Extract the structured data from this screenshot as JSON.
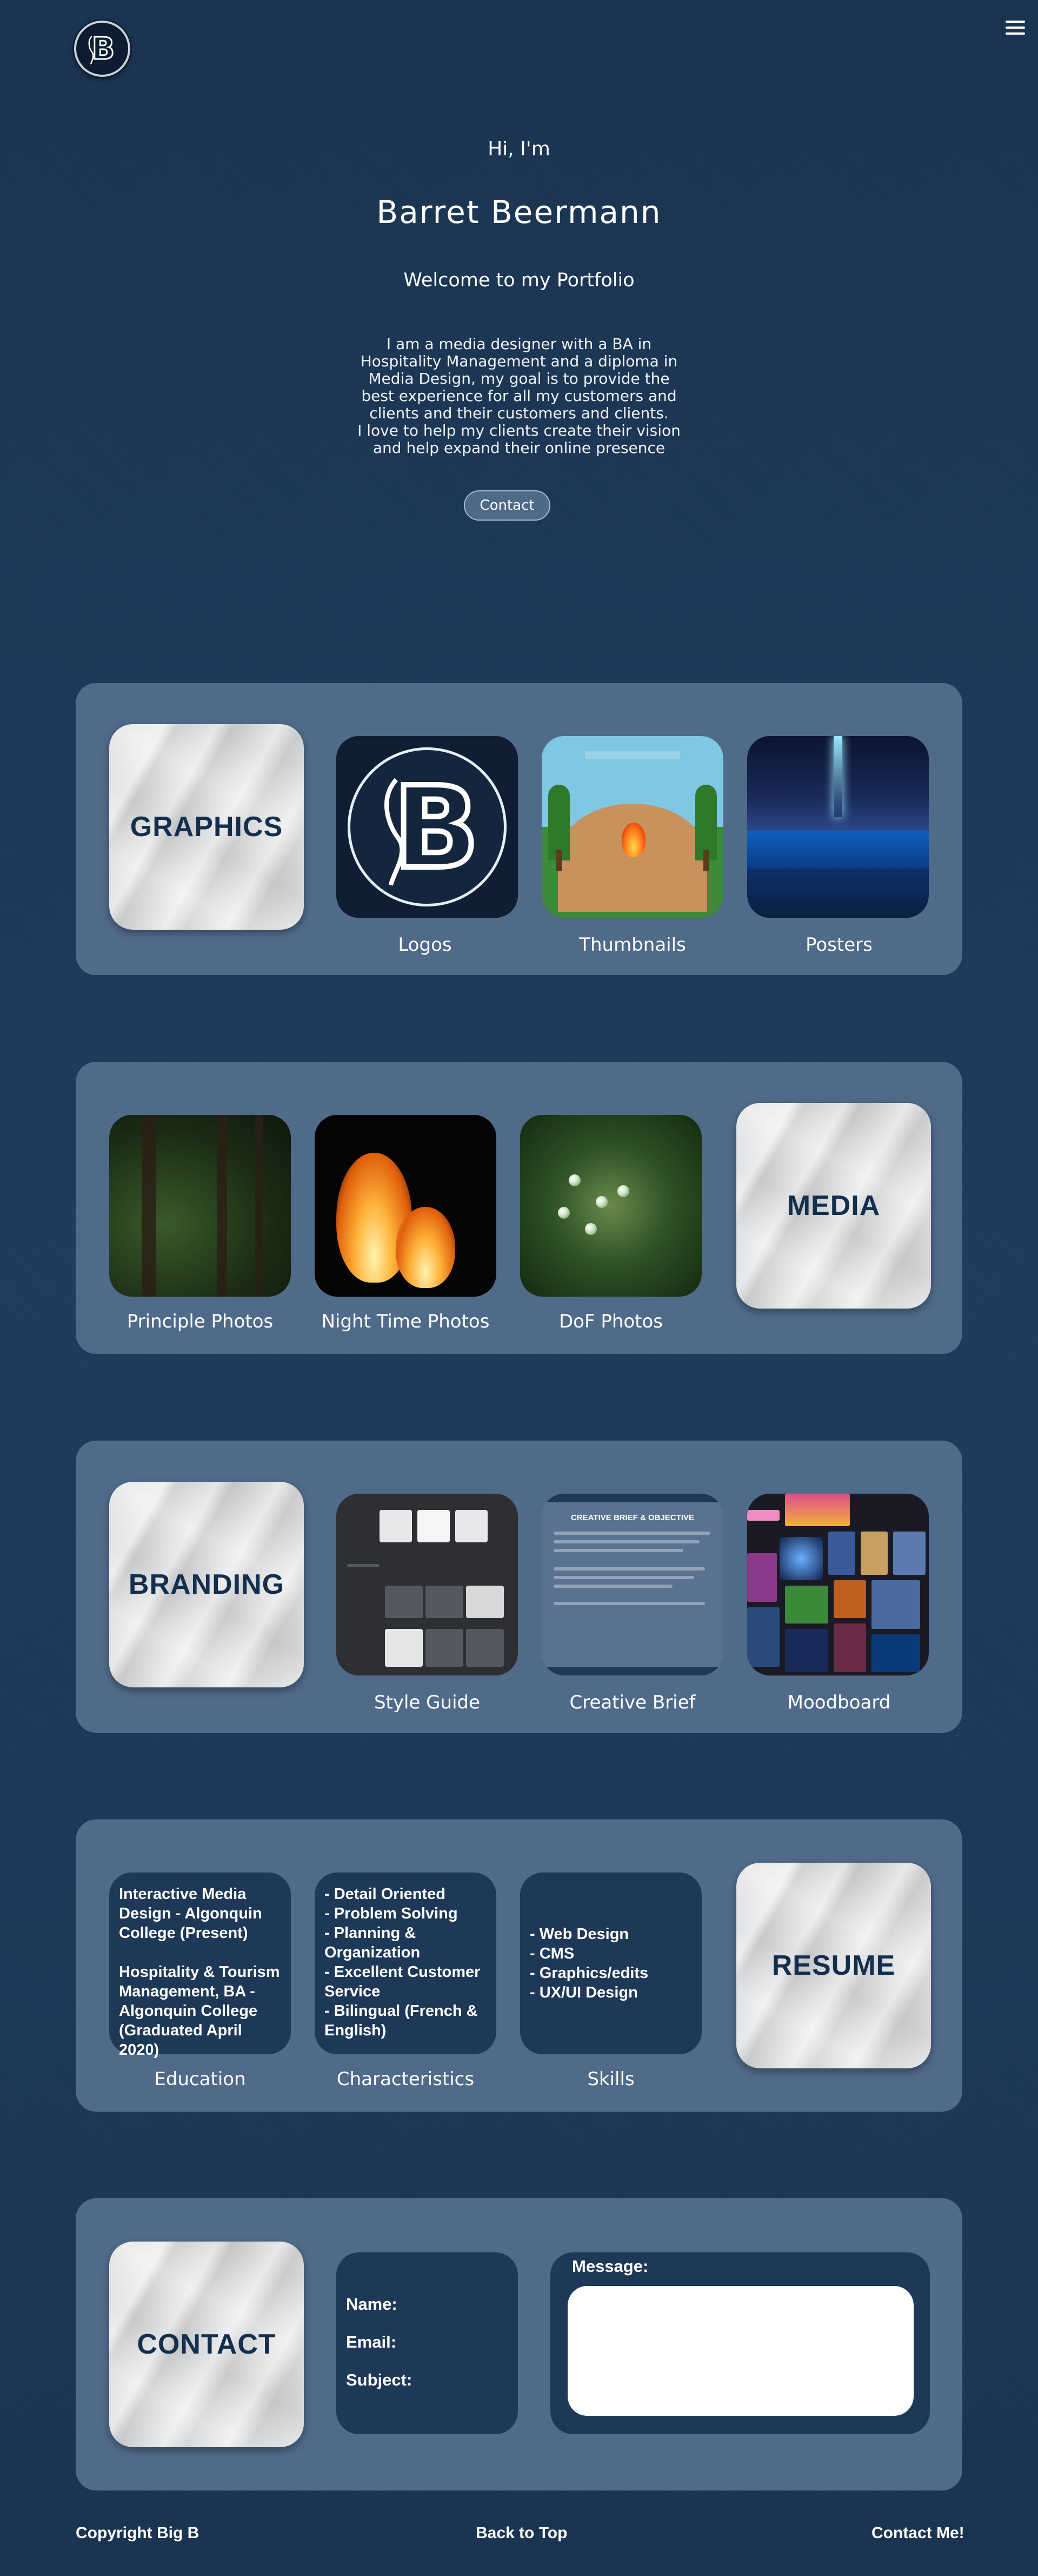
{
  "header": {
    "logo_letter": "B",
    "menu_icon": "hamburger-menu-icon"
  },
  "hero": {
    "greeting": "Hi, I'm",
    "name": "Barret Beermann",
    "welcome": "Welcome to my Portfolio",
    "bio_lines": [
      "I am a media designer with a BA in",
      "Hospitality Management and a diploma in",
      "Media Design, my goal is to provide the",
      "best experience for all my customers and",
      "clients and their customers and clients.",
      "I love to help my clients create their vision",
      "and help expand their online presence"
    ],
    "contact_button": "Contact"
  },
  "graphics": {
    "title": "GRAPHICS",
    "items": [
      {
        "label": "Logos"
      },
      {
        "label": "Thumbnails"
      },
      {
        "label": "Posters"
      }
    ]
  },
  "media": {
    "title": "MEDIA",
    "items": [
      {
        "label": "Principle Photos"
      },
      {
        "label": "Night Time Photos"
      },
      {
        "label": "DoF Photos"
      }
    ]
  },
  "branding": {
    "title": "BRANDING",
    "creative_brief_heading": "CREATIVE BRIEF & OBJECTIVE",
    "items": [
      {
        "label": "Style Guide"
      },
      {
        "label": "Creative Brief"
      },
      {
        "label": "Moodboard"
      }
    ]
  },
  "resume": {
    "title": "RESUME",
    "education_lines": [
      "Interactive Media",
      "Design - Algonquin",
      "College (Present)",
      "",
      "Hospitality & Tourism",
      "Management, BA -",
      "Algonquin College",
      "(Graduated April 2020)"
    ],
    "characteristics_lines": [
      "- Detail Oriented",
      "- Problem Solving",
      "- Planning &",
      "Organization",
      "- Excellent Customer",
      "Service",
      "- Bilingual (French &",
      "English)"
    ],
    "skills_lines": [
      "- Web Design",
      "- CMS",
      "- Graphics/edits",
      "- UX/UI Design"
    ],
    "labels": {
      "education": "Education",
      "characteristics": "Characteristics",
      "skills": "Skills"
    }
  },
  "contact": {
    "title": "CONTACT",
    "name_label": "Name:",
    "email_label": "Email:",
    "subject_label": "Subject:",
    "message_label": "Message:"
  },
  "footer": {
    "copyright": "Copyright Big B",
    "back_to_top": "Back to Top",
    "contact_me": "Contact Me!"
  },
  "colors": {
    "background": "#1a3656",
    "panel": "#506a8a",
    "dark_tile": "#1e3857",
    "paper_text": "#142e4d"
  }
}
